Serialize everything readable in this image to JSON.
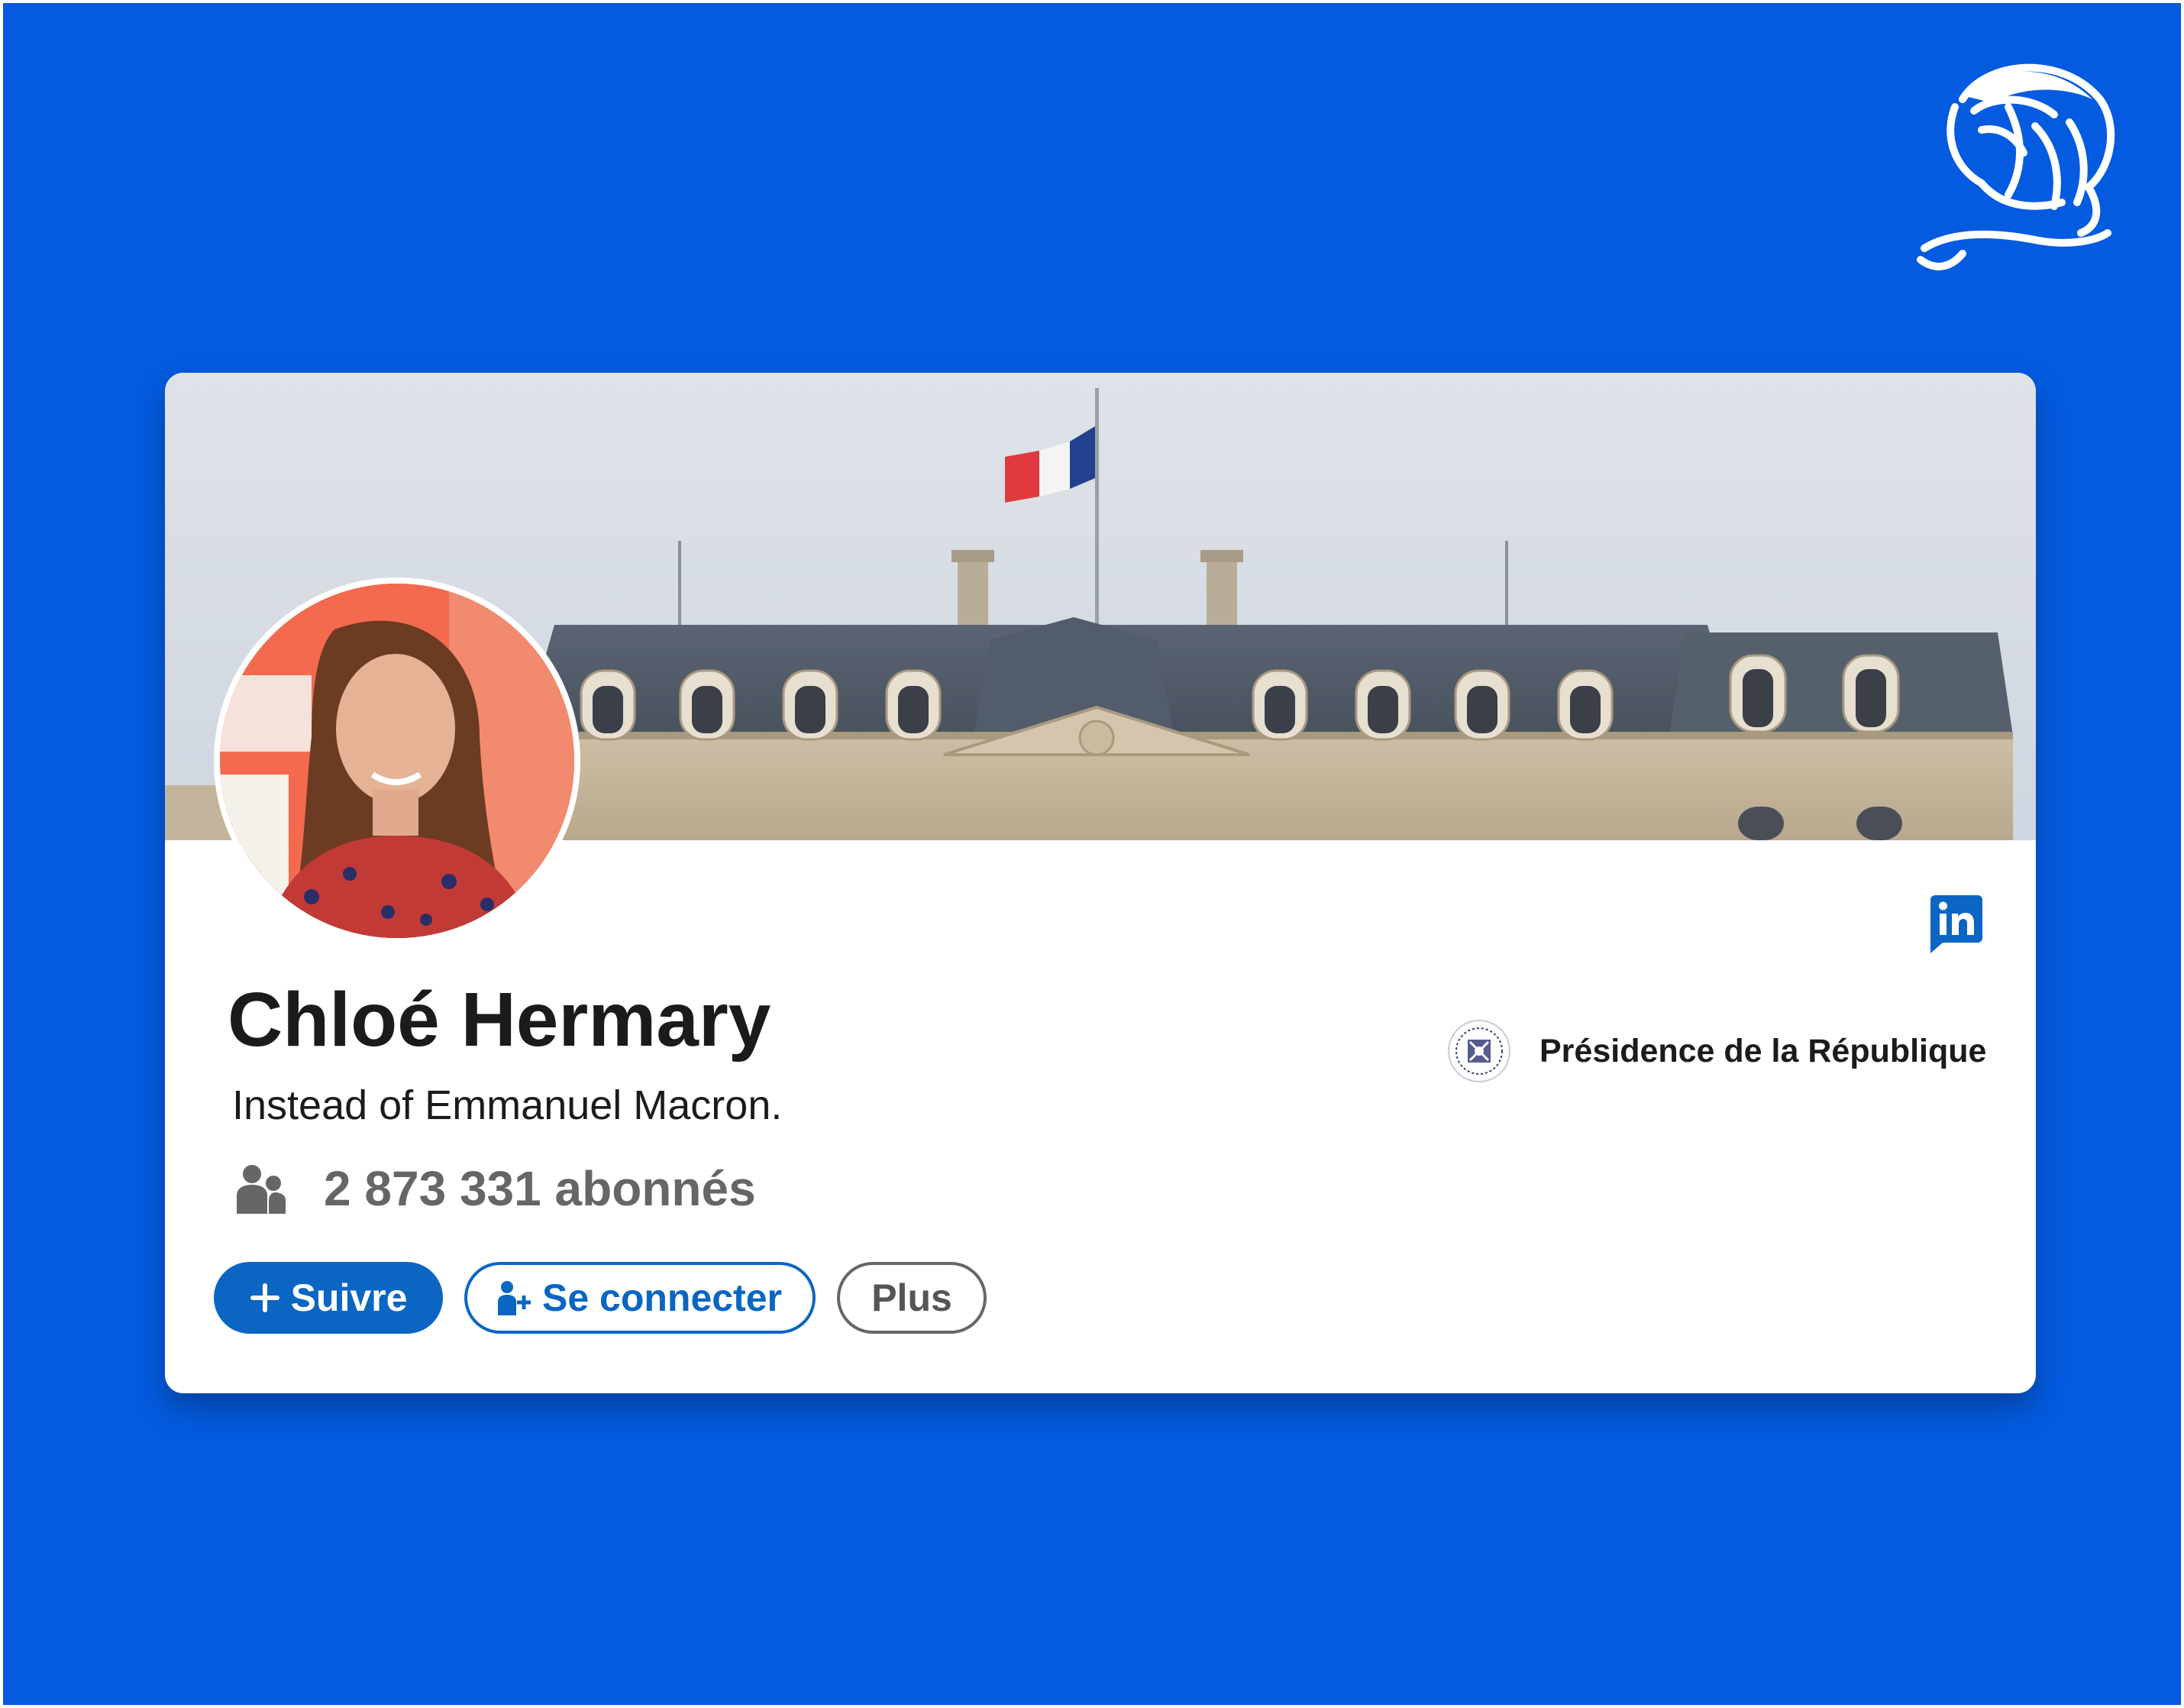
{
  "profile": {
    "name": "Chloé Hermary",
    "headline": "Instead of Emmanuel Macron.",
    "followers": "2 873 331 abonnés"
  },
  "organization": {
    "name": "Présidence de la République"
  },
  "actions": {
    "follow_label": "Suivre",
    "connect_label": "Se connecter",
    "more_label": "Plus"
  },
  "icons": {
    "brand": "linkedin-icon",
    "followers": "people-icon",
    "follow": "plus-icon",
    "connect": "add-person-icon",
    "corner_logo": "lion-logo"
  },
  "colors": {
    "background": "#045BE0",
    "linkedin_blue": "#0A66C2",
    "text": "#1b1b1b",
    "muted": "#666666"
  }
}
